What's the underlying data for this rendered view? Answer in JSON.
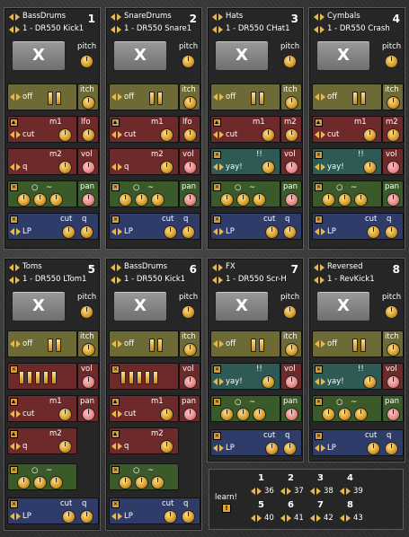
{
  "pads": [
    {
      "name": "BassDrums",
      "num": "1",
      "preset": "1 - DR550 Kick1"
    },
    {
      "name": "SnareDrums",
      "num": "2",
      "preset": "1 - DR550 Snare1"
    },
    {
      "name": "Hats",
      "num": "3",
      "preset": "1 - DR550 CHat1"
    },
    {
      "name": "Cymbals",
      "num": "4",
      "preset": "1 - DR550 Crash"
    },
    {
      "name": "Toms",
      "num": "5",
      "preset": "1 - DR550 LTom1"
    },
    {
      "name": "BassDrums",
      "num": "6",
      "preset": "1 - DR550 Kick1"
    },
    {
      "name": "FX",
      "num": "7",
      "preset": "1 - DR550 Scr-H"
    },
    {
      "name": "Reversed",
      "num": "8",
      "preset": "1 - RevKick1"
    }
  ],
  "labels": {
    "x": "X",
    "pitch": "pitch",
    "itch": "itch",
    "off": "off",
    "cut": "cut",
    "m1": "m1",
    "m2": "m2",
    "lfo": "lfo",
    "vol": "vol",
    "pan": "pan",
    "q": "q",
    "lp": "LP",
    "yay": "yay!",
    "ex": "!!",
    "circ": "○",
    "tilde": "~"
  },
  "learn": {
    "label": "learn!",
    "items": [
      {
        "n": "1",
        "v": "36"
      },
      {
        "n": "2",
        "v": "37"
      },
      {
        "n": "3",
        "v": "38"
      },
      {
        "n": "4",
        "v": "39"
      },
      {
        "n": "5",
        "v": "40"
      },
      {
        "n": "6",
        "v": "41"
      },
      {
        "n": "7",
        "v": "42"
      },
      {
        "n": "8",
        "v": "43"
      }
    ]
  },
  "colors": {
    "knob": "#e0a830",
    "pink_knob": "#e58888",
    "olive": "#6d6a35",
    "red": "#6e2a2a",
    "blue": "#2f3b68",
    "teal": "#2d5a55",
    "green": "#3a5a2a"
  }
}
